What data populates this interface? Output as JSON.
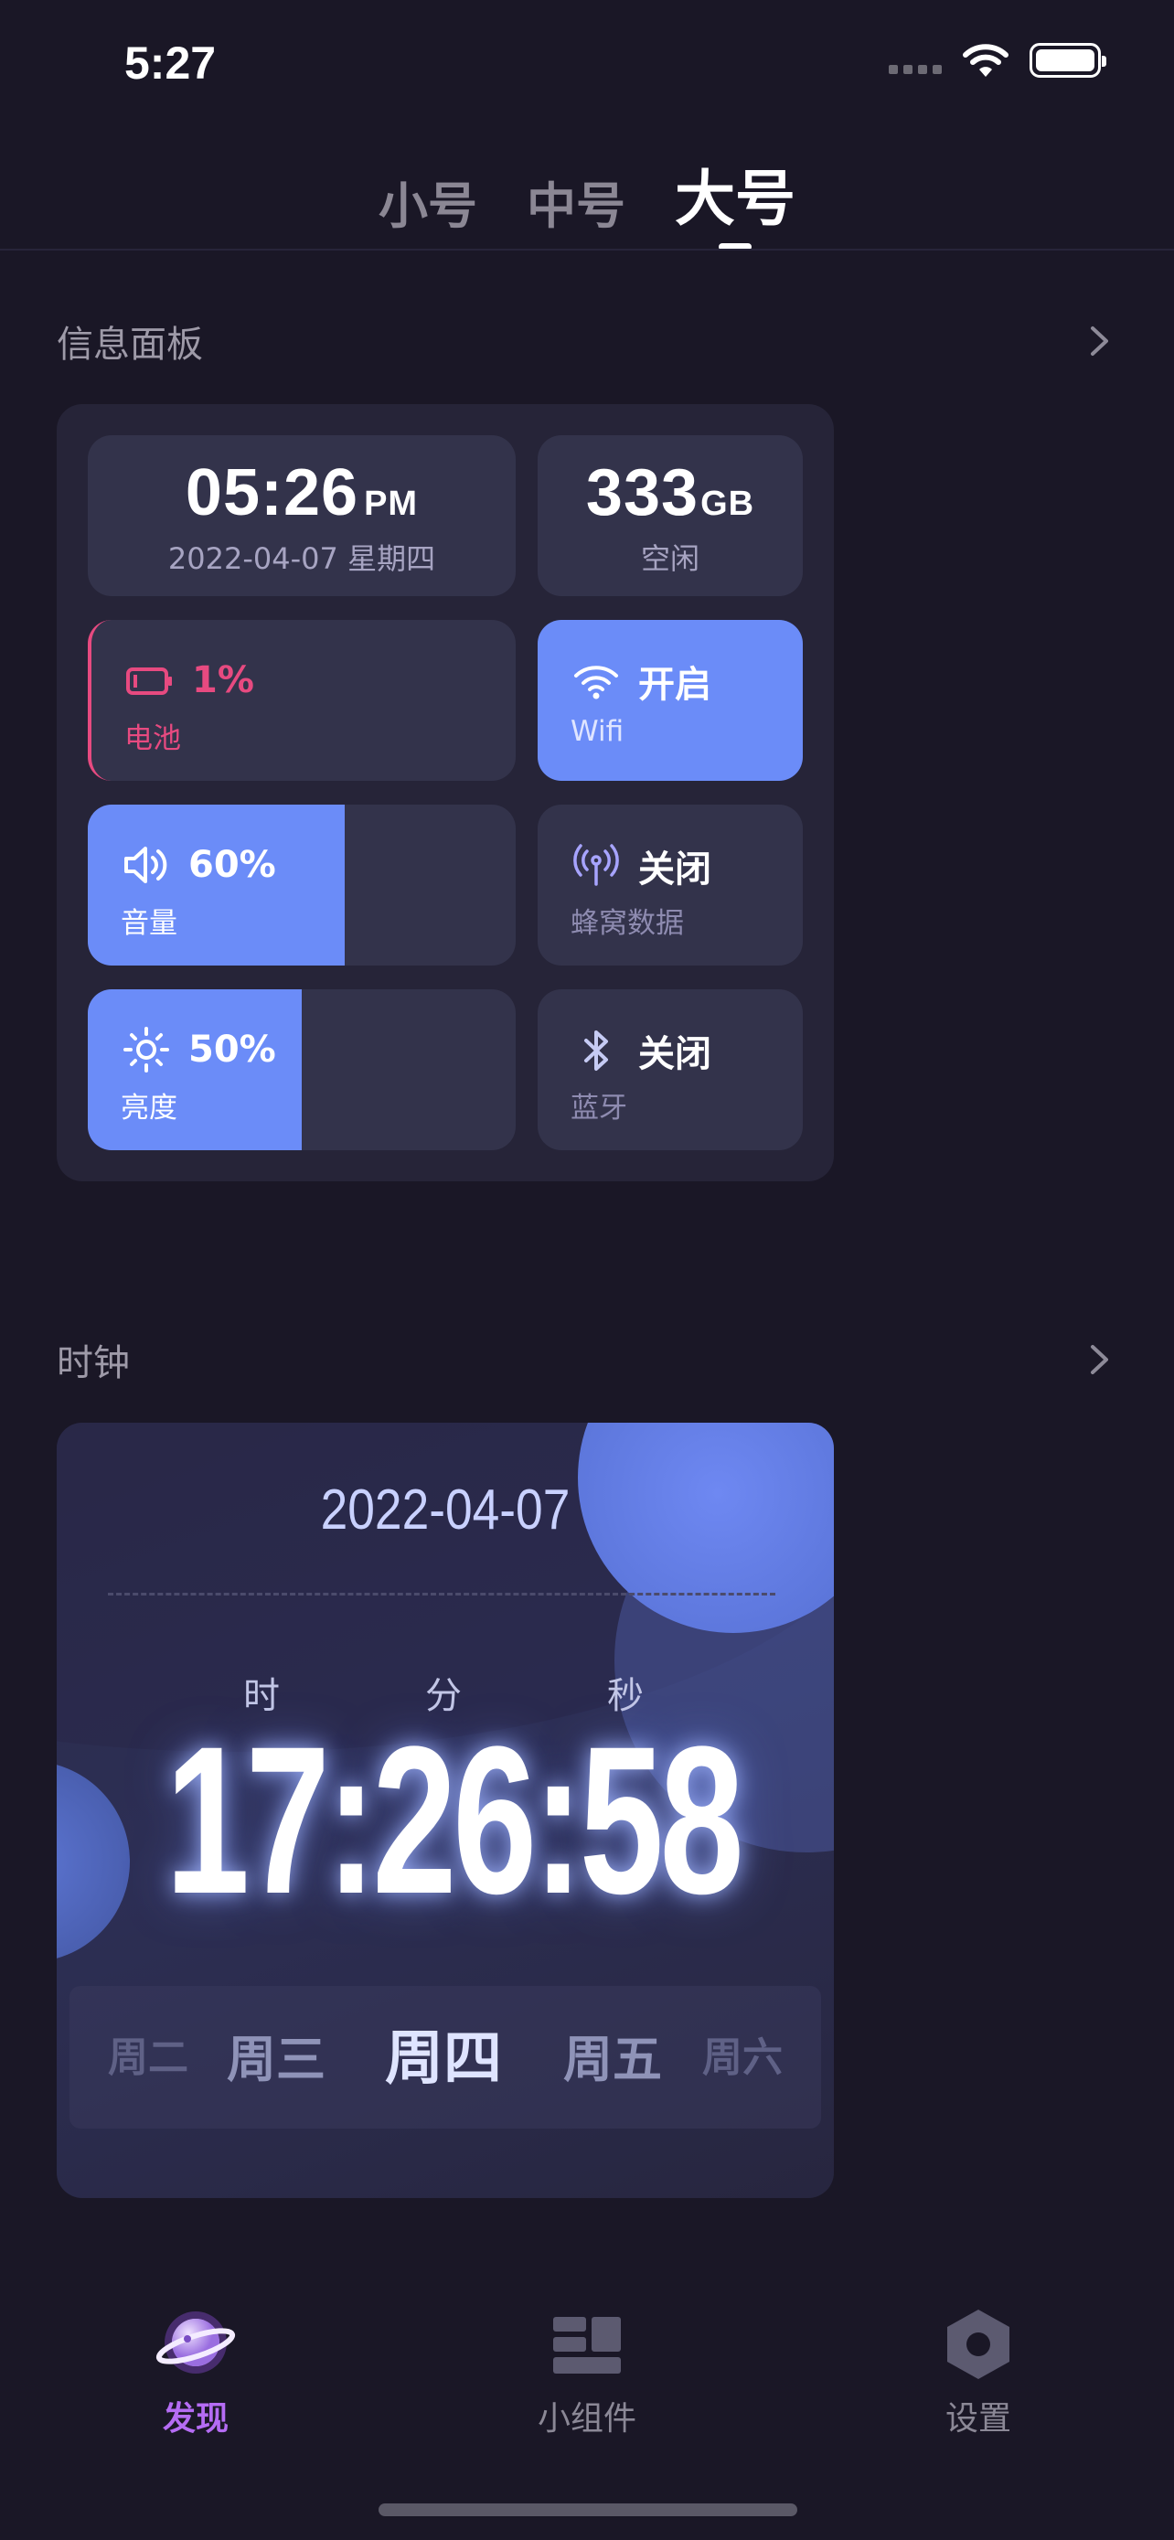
{
  "status_bar": {
    "time": "5:27"
  },
  "size_tabs": [
    {
      "label": "小号",
      "active": false
    },
    {
      "label": "中号",
      "active": false
    },
    {
      "label": "大号",
      "active": true
    }
  ],
  "info_section": {
    "title": "信息面板",
    "time": {
      "value": "05:26",
      "meridiem": "PM",
      "date": "2022-04-07  星期四"
    },
    "storage": {
      "value": "333",
      "unit": "GB",
      "label": "空闲"
    },
    "battery": {
      "value": "1%",
      "label": "电池",
      "level": 0.01,
      "color": "#e74a80"
    },
    "wifi": {
      "value": "开启",
      "label": "Wifi",
      "on": true
    },
    "volume": {
      "value": "60%",
      "label": "音量",
      "level": 0.6
    },
    "cellular": {
      "value": "关闭",
      "label": "蜂窝数据",
      "on": false
    },
    "brightness": {
      "value": "50%",
      "label": "亮度",
      "level": 0.5
    },
    "bluetooth": {
      "value": "关闭",
      "label": "蓝牙",
      "on": false
    },
    "accent": "#6b8cf8"
  },
  "clock_section": {
    "title": "时钟",
    "date": "2022-04-07",
    "labels": {
      "hour": "时",
      "minute": "分",
      "second": "秒"
    },
    "time": "17:26:58",
    "weekdays": [
      "周二",
      "周三",
      "周四",
      "周五",
      "周六"
    ],
    "current_weekday": "周四"
  },
  "tab_bar": {
    "items": [
      {
        "label": "发现",
        "icon": "planet-icon",
        "active": true
      },
      {
        "label": "小组件",
        "icon": "widgets-icon",
        "active": false
      },
      {
        "label": "设置",
        "icon": "settings-hex-icon",
        "active": false
      }
    ],
    "active_color": "#b56cf4"
  }
}
